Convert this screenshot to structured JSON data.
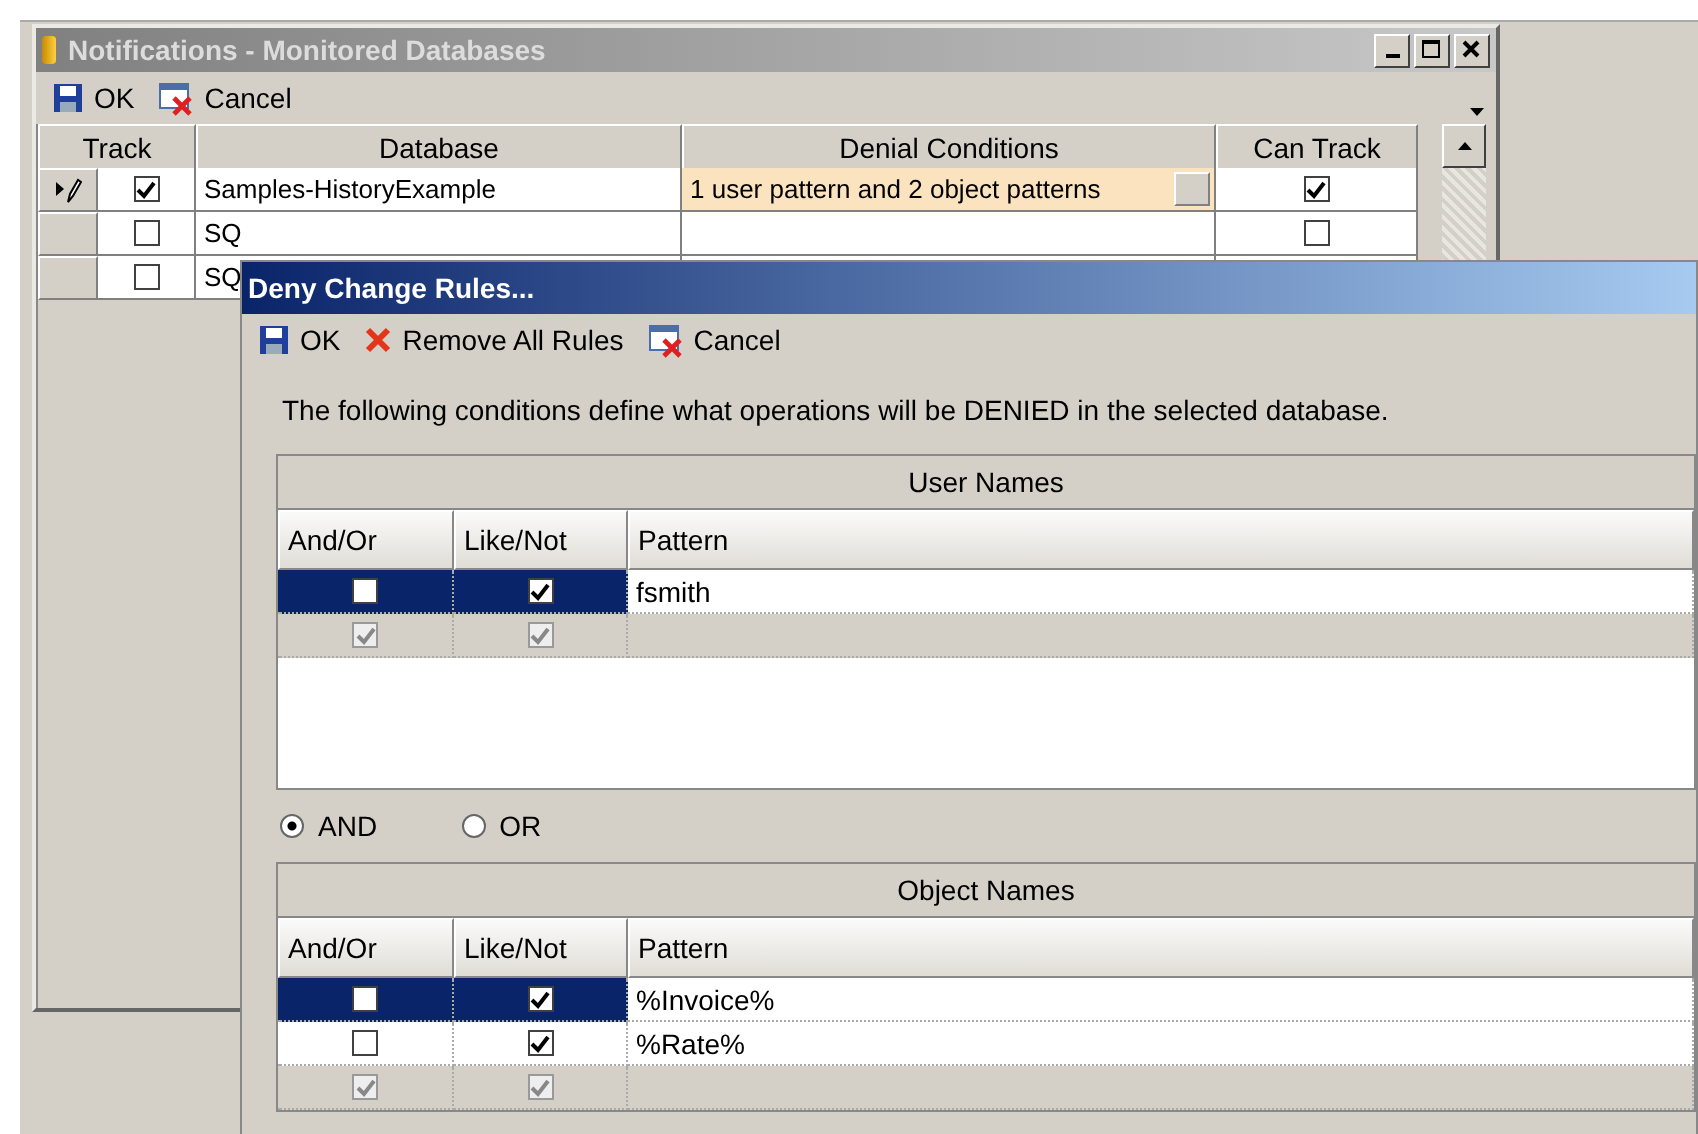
{
  "main_window": {
    "title": "Notifications - Monitored Databases",
    "toolbar": [
      {
        "kind": "save",
        "label": "OK"
      },
      {
        "kind": "cancel",
        "label": "Cancel"
      }
    ],
    "table": {
      "columns": [
        "Track",
        "Database",
        "Denial Conditions",
        "Can Track"
      ],
      "rows": [
        {
          "editing": true,
          "track": true,
          "database": "Samples-HistoryExample",
          "conditions": "1 user pattern and 2 object patterns",
          "can_track": true
        },
        {
          "editing": false,
          "track": false,
          "database": "SQ",
          "can_track": false
        },
        {
          "editing": false,
          "track": false,
          "database": "SQ"
        }
      ]
    }
  },
  "dialog": {
    "title": "Deny Change Rules...",
    "toolbar": [
      {
        "kind": "save",
        "label": "OK"
      },
      {
        "kind": "remove",
        "label": "Remove All Rules"
      },
      {
        "kind": "cancel",
        "label": "Cancel"
      }
    ],
    "description": "The following conditions define what operations will be DENIED in the selected database.",
    "user_names": {
      "title": "User Names",
      "columns": [
        "And/Or",
        "Like/Not",
        "Pattern"
      ],
      "rows": [
        {
          "kind": "rule",
          "selected": true,
          "and_or": false,
          "like_not": true,
          "pattern": "fsmith"
        },
        {
          "kind": "new",
          "selected": false,
          "and_or": true,
          "like_not": true
        }
      ]
    },
    "combine": [
      {
        "label": "AND",
        "selected": true
      },
      {
        "label": "OR",
        "selected": false
      }
    ],
    "object_names": {
      "title": "Object Names",
      "columns": [
        "And/Or",
        "Like/Not",
        "Pattern"
      ],
      "rows": [
        {
          "kind": "rule",
          "selected": true,
          "and_or": false,
          "like_not": true,
          "pattern": "%Invoice%"
        },
        {
          "kind": "rule",
          "selected": false,
          "and_or": false,
          "like_not": true,
          "pattern": "%Rate%"
        },
        {
          "kind": "new",
          "selected": false,
          "and_or": true,
          "like_not": true
        }
      ]
    }
  }
}
